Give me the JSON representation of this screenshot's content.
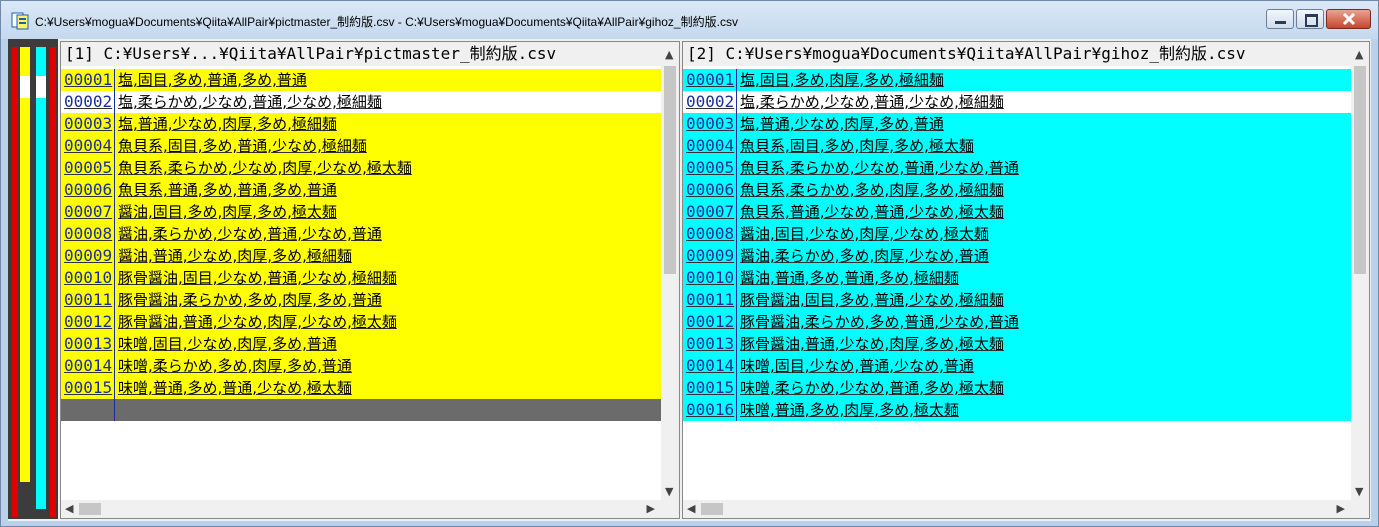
{
  "window": {
    "title": "C:¥Users¥mogua¥Documents¥Qiita¥AllPair¥pictmaster_制約版.csv  -  C:¥Users¥mogua¥Documents¥Qiita¥AllPair¥gihoz_制約版.csv"
  },
  "left_pane": {
    "header": "[1] C:¥Users¥...¥Qiita¥AllPair¥pictmaster_制約版.csv",
    "rows": [
      {
        "ln": "00001",
        "text": "塩,固目,多め,普通,多め,普通"
      },
      {
        "ln": "00002",
        "text": "塩,柔らかめ,少なめ,普通,少なめ,極細麺"
      },
      {
        "ln": "00003",
        "text": "塩,普通,少なめ,肉厚,多め,極細麺"
      },
      {
        "ln": "00004",
        "text": "魚貝系,固目,多め,普通,少なめ,極細麺"
      },
      {
        "ln": "00005",
        "text": "魚貝系,柔らかめ,少なめ,肉厚,少なめ,極太麺"
      },
      {
        "ln": "00006",
        "text": "魚貝系,普通,多め,普通,多め,普通"
      },
      {
        "ln": "00007",
        "text": "醤油,固目,多め,肉厚,多め,極太麺"
      },
      {
        "ln": "00008",
        "text": "醤油,柔らかめ,少なめ,普通,少なめ,普通"
      },
      {
        "ln": "00009",
        "text": "醤油,普通,少なめ,肉厚,多め,極細麺"
      },
      {
        "ln": "00010",
        "text": "豚骨醤油,固目,少なめ,普通,少なめ,極細麺"
      },
      {
        "ln": "00011",
        "text": "豚骨醤油,柔らかめ,多め,肉厚,多め,普通"
      },
      {
        "ln": "00012",
        "text": "豚骨醤油,普通,少なめ,肉厚,少なめ,極太麺"
      },
      {
        "ln": "00013",
        "text": "味噌,固目,少なめ,肉厚,多め,普通"
      },
      {
        "ln": "00014",
        "text": "味噌,柔らかめ,多め,肉厚,多め,普通"
      },
      {
        "ln": "00015",
        "text": "味噌,普通,多め,普通,少なめ,極太麺"
      }
    ]
  },
  "right_pane": {
    "header": "[2] C:¥Users¥mogua¥Documents¥Qiita¥AllPair¥gihoz_制約版.csv",
    "rows": [
      {
        "ln": "00001",
        "text": "塩,固目,多め,肉厚,多め,極細麺"
      },
      {
        "ln": "00002",
        "text": "塩,柔らかめ,少なめ,普通,少なめ,極細麺"
      },
      {
        "ln": "00003",
        "text": "塩,普通,少なめ,肉厚,多め,普通"
      },
      {
        "ln": "00004",
        "text": "魚貝系,固目,多め,肉厚,多め,極太麺"
      },
      {
        "ln": "00005",
        "text": "魚貝系,柔らかめ,少なめ,普通,少なめ,普通"
      },
      {
        "ln": "00006",
        "text": "魚貝系,柔らかめ,多め,肉厚,多め,極細麺"
      },
      {
        "ln": "00007",
        "text": "魚貝系,普通,少なめ,普通,少なめ,極太麺"
      },
      {
        "ln": "00008",
        "text": "醤油,固目,少なめ,肉厚,少なめ,極太麺"
      },
      {
        "ln": "00009",
        "text": "醤油,柔らかめ,多め,肉厚,少なめ,普通"
      },
      {
        "ln": "00010",
        "text": "醤油,普通,多め,普通,多め,極細麺"
      },
      {
        "ln": "00011",
        "text": "豚骨醤油,固目,多め,普通,少なめ,極細麺"
      },
      {
        "ln": "00012",
        "text": "豚骨醤油,柔らかめ,多め,普通,少なめ,普通"
      },
      {
        "ln": "00013",
        "text": "豚骨醤油,普通,少なめ,肉厚,多め,極太麺"
      },
      {
        "ln": "00014",
        "text": "味噌,固目,少なめ,普通,少なめ,普通"
      },
      {
        "ln": "00015",
        "text": "味噌,柔らかめ,少なめ,普通,多め,極太麺"
      },
      {
        "ln": "00016",
        "text": "味噌,普通,多め,肉厚,多め,極太麺"
      }
    ]
  },
  "colors": {
    "left_diff": "#ffff00",
    "right_diff": "#00ffff",
    "same": "#ffffff",
    "overview_marker": "#e00000"
  }
}
